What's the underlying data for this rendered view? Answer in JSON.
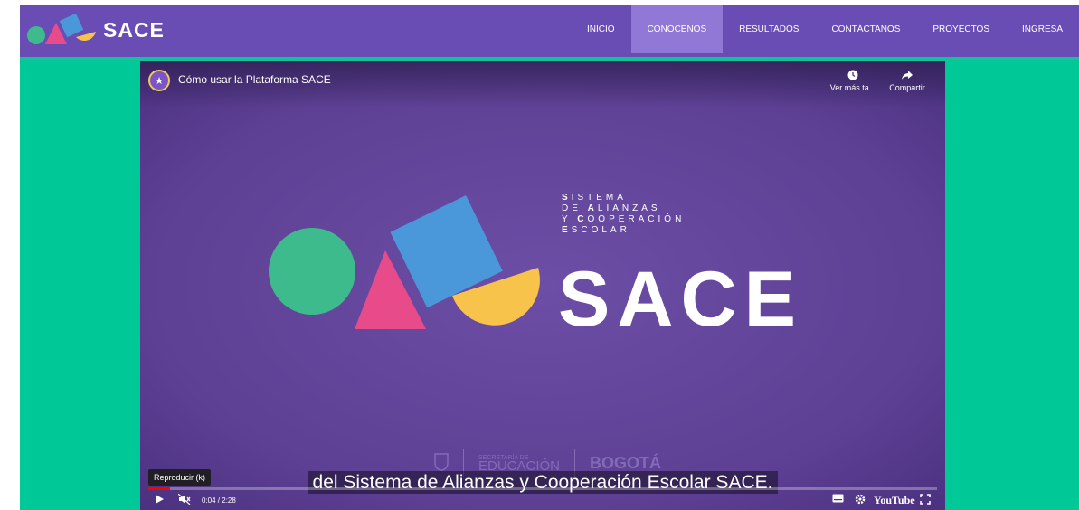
{
  "header": {
    "brand": "SACE",
    "menu": [
      {
        "label": "INICIO",
        "active": false
      },
      {
        "label": "CONÓCENOS",
        "active": true
      },
      {
        "label": "RESULTADOS",
        "active": false
      },
      {
        "label": "CONTÁCTANOS",
        "active": false
      },
      {
        "label": "PROYECTOS",
        "active": false
      },
      {
        "label": "INGRESA",
        "active": false
      }
    ]
  },
  "video": {
    "title": "Cómo usar la Plataforma SACE",
    "watch_later_label": "Ver más ta...",
    "share_label": "Compartir",
    "frame": {
      "subtitle_lines": [
        [
          {
            "b": "S",
            "r": "ISTEMA"
          }
        ],
        [
          {
            "b": "",
            "r": "DE "
          },
          {
            "b": "A",
            "r": "LIANZAS"
          }
        ],
        [
          {
            "b": "",
            "r": "Y "
          },
          {
            "b": "C",
            "r": "OOPERACIÓN"
          }
        ],
        [
          {
            "b": "E",
            "r": "SCOLAR"
          }
        ]
      ],
      "big_title": "SACE",
      "watermark_edu_small": "SECRETARÍA DE",
      "watermark_edu": "EDUCACIÓN",
      "watermark_city": "BOGOTÁ"
    },
    "captions": "del Sistema de Alianzas y Cooperación Escolar SACE.",
    "tooltip": "Reproducir (k)",
    "time": "0:04 / 2:28",
    "progress_fraction": 0.027,
    "youtube_label": "YouTube"
  },
  "colors": {
    "nav": "#6a4cb5",
    "page": "#00c896",
    "circle": "#3dbb8c",
    "triangle": "#e84b8a",
    "square": "#4a98d9",
    "half": "#f7c34b"
  }
}
